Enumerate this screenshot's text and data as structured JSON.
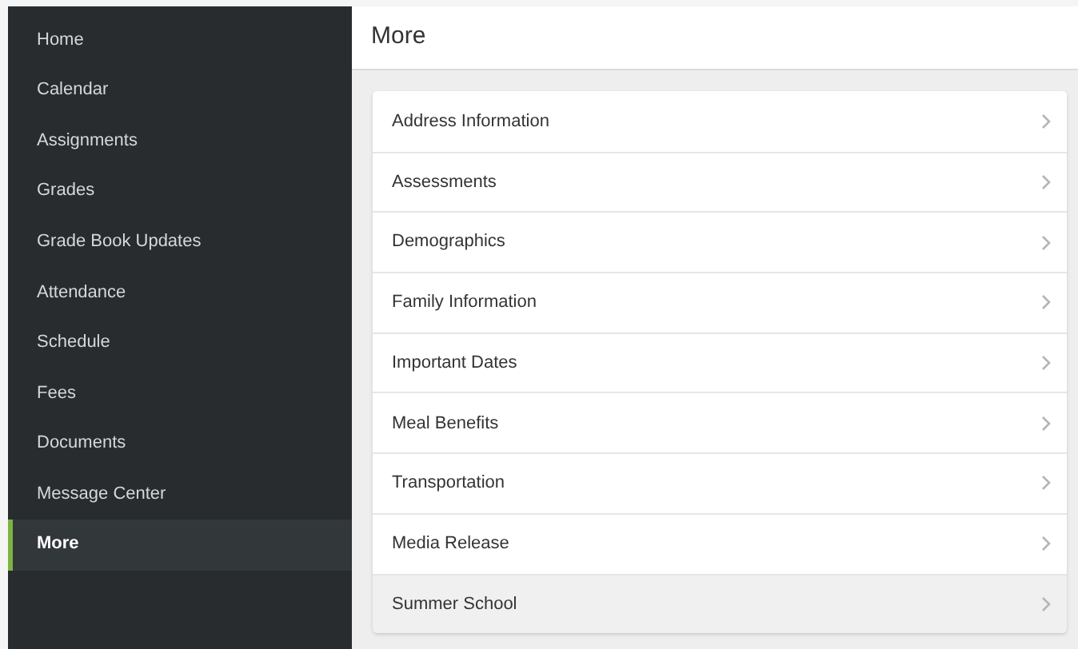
{
  "sidebar": {
    "items": [
      {
        "label": "Home",
        "selected": false
      },
      {
        "label": "Calendar",
        "selected": false
      },
      {
        "label": "Assignments",
        "selected": false
      },
      {
        "label": "Grades",
        "selected": false
      },
      {
        "label": "Grade Book Updates",
        "selected": false
      },
      {
        "label": "Attendance",
        "selected": false
      },
      {
        "label": "Schedule",
        "selected": false
      },
      {
        "label": "Fees",
        "selected": false
      },
      {
        "label": "Documents",
        "selected": false
      },
      {
        "label": "Message Center",
        "selected": false
      },
      {
        "label": "More",
        "selected": true
      }
    ]
  },
  "header": {
    "title": "More"
  },
  "list": {
    "items": [
      {
        "label": "Address Information",
        "highlighted": false
      },
      {
        "label": "Assessments",
        "highlighted": false
      },
      {
        "label": "Demographics",
        "highlighted": false
      },
      {
        "label": "Family Information",
        "highlighted": false
      },
      {
        "label": "Important Dates",
        "highlighted": false
      },
      {
        "label": "Meal Benefits",
        "highlighted": false
      },
      {
        "label": "Transportation",
        "highlighted": false
      },
      {
        "label": "Media Release",
        "highlighted": false
      },
      {
        "label": "Summer School",
        "highlighted": true
      }
    ]
  }
}
